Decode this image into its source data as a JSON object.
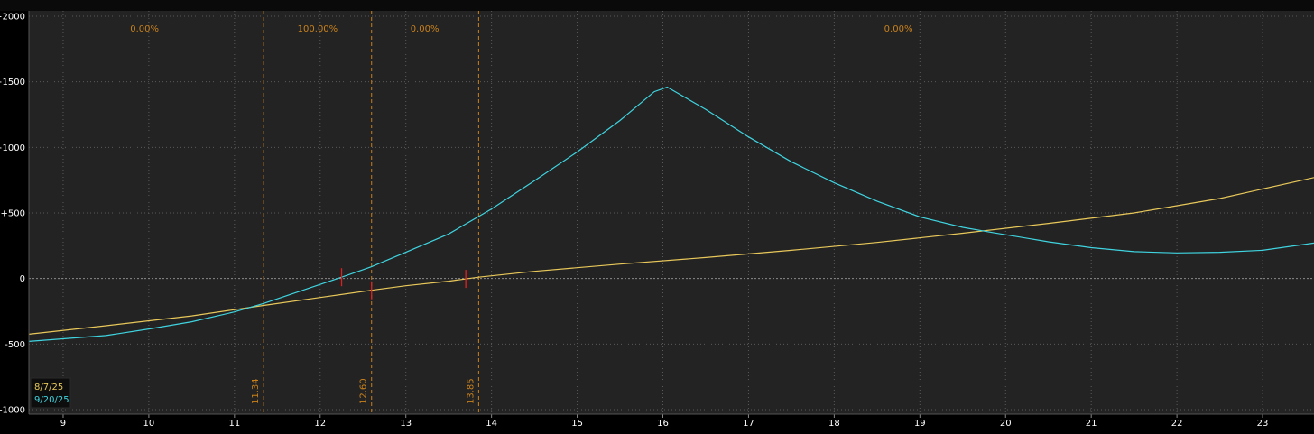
{
  "chart_data": {
    "type": "line",
    "xlim": [
      8.6,
      23.6
    ],
    "ylim": [
      -1000,
      2000
    ],
    "x_ticks": [
      9,
      10,
      11,
      12,
      13,
      14,
      15,
      16,
      17,
      18,
      19,
      20,
      21,
      22,
      23
    ],
    "y_ticks": [
      {
        "value": 2000,
        "label": "+2000"
      },
      {
        "value": 1500,
        "label": "+1500"
      },
      {
        "value": 1000,
        "label": "+1000"
      },
      {
        "value": 500,
        "label": "+500"
      },
      {
        "value": 0,
        "label": "0"
      },
      {
        "value": -500,
        "label": "-500"
      },
      {
        "value": -1000,
        "label": "-1000"
      }
    ],
    "grid": true,
    "zero_line": true,
    "vertical_markers": [
      {
        "x": 11.34,
        "label": "11.34"
      },
      {
        "x": 12.6,
        "label": "12.60"
      },
      {
        "x": 13.85,
        "label": "13.85"
      }
    ],
    "zone_labels": [
      {
        "x": 9.95,
        "label": "0.00%"
      },
      {
        "x": 11.97,
        "label": "100.00%"
      },
      {
        "x": 13.22,
        "label": "0.00%"
      },
      {
        "x": 18.75,
        "label": "0.00%"
      }
    ],
    "series": [
      {
        "name": "8/7/25",
        "color": "#e8c85a",
        "x": [
          8.6,
          9.5,
          10.5,
          11.34,
          12.0,
          12.6,
          13.0,
          13.5,
          13.85,
          14.5,
          15.5,
          16.5,
          17.5,
          18.5,
          19.5,
          20.5,
          21.5,
          22.5,
          23.6
        ],
        "y": [
          -425,
          -360,
          -285,
          -205,
          -145,
          -90,
          -55,
          -20,
          10,
          55,
          110,
          160,
          215,
          275,
          345,
          420,
          500,
          610,
          770
        ]
      },
      {
        "name": "9/20/25",
        "color": "#3fd4e0",
        "x": [
          8.6,
          9.5,
          10.0,
          10.5,
          11.0,
          11.34,
          12.0,
          12.25,
          12.6,
          13.0,
          13.5,
          14.0,
          14.5,
          15.0,
          15.5,
          15.9,
          16.05,
          16.5,
          17.0,
          17.5,
          18.0,
          18.5,
          19.0,
          19.5,
          19.85,
          20.5,
          21.0,
          21.5,
          22.0,
          22.5,
          23.0,
          23.6
        ],
        "y": [
          -480,
          -435,
          -385,
          -330,
          -255,
          -190,
          -45,
          10,
          90,
          200,
          340,
          530,
          745,
          965,
          1205,
          1425,
          1460,
          1290,
          1080,
          890,
          730,
          590,
          470,
          390,
          350,
          280,
          235,
          205,
          195,
          200,
          215,
          270
        ]
      }
    ],
    "breakeven_marks": [
      {
        "x": 12.25,
        "series": 1
      },
      {
        "x": 12.6,
        "series": 0
      },
      {
        "x": 13.7,
        "series": 0
      }
    ],
    "legend": {
      "placement": "bottom-left",
      "entries": [
        {
          "label": "8/7/25",
          "color": "#e8c85a"
        },
        {
          "label": "9/20/25",
          "color": "#3fd4e0"
        }
      ]
    }
  }
}
